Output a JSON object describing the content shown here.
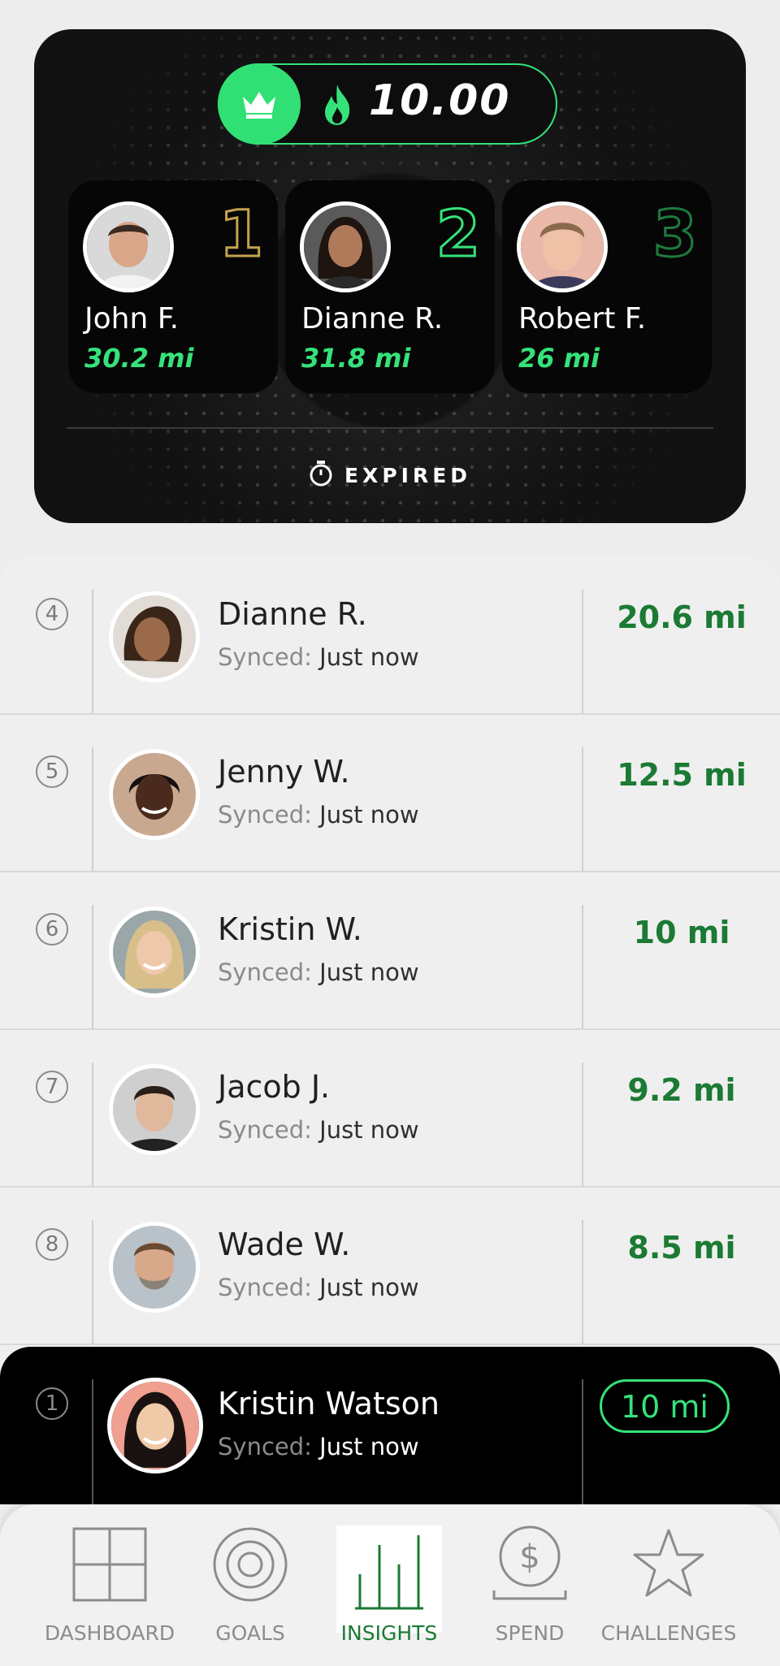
{
  "pot": {
    "amount": "10.00",
    "crown_icon": "crown-icon",
    "flame_icon": "flame-icon"
  },
  "podium": [
    {
      "rank": "1",
      "name": "John F.",
      "distance": "30.2 mi"
    },
    {
      "rank": "2",
      "name": "Dianne R.",
      "distance": "31.8 mi"
    },
    {
      "rank": "3",
      "name": "Robert F.",
      "distance": "26 mi"
    }
  ],
  "status": {
    "label": "EXPIRED",
    "icon": "stopwatch-icon"
  },
  "leaderboard": [
    {
      "rank": "4",
      "name": "Dianne R.",
      "synced_label": "Synced:",
      "synced_value": "Just now",
      "distance": "20.6  mi"
    },
    {
      "rank": "5",
      "name": "Jenny W.",
      "synced_label": "Synced:",
      "synced_value": "Just now",
      "distance": "12.5  mi"
    },
    {
      "rank": "6",
      "name": "Kristin W.",
      "synced_label": "Synced:",
      "synced_value": "Just now",
      "distance": "10 mi"
    },
    {
      "rank": "7",
      "name": "Jacob J.",
      "synced_label": "Synced:",
      "synced_value": "Just now",
      "distance": "9.2 mi"
    },
    {
      "rank": "8",
      "name": "Wade W.",
      "synced_label": "Synced:",
      "synced_value": "Just now",
      "distance": "8.5  mi"
    }
  ],
  "current_user": {
    "rank": "1",
    "name": "Kristin Watson",
    "synced_label": "Synced:",
    "synced_value": "Just now",
    "distance": "10 mi"
  },
  "tabs": [
    {
      "label": "DASHBOARD",
      "icon": "dashboard-grid-icon"
    },
    {
      "label": "GOALS",
      "icon": "target-icon"
    },
    {
      "label": "INSIGHTS",
      "icon": "bar-chart-icon",
      "active": true
    },
    {
      "label": "SPEND",
      "icon": "dollar-icon"
    },
    {
      "label": "CHALLENGES",
      "icon": "star-icon"
    }
  ],
  "colors": {
    "accent": "#35e27a",
    "distance_green": "#1b7a33",
    "gold": "#c4a34f",
    "dark": "#121212"
  }
}
